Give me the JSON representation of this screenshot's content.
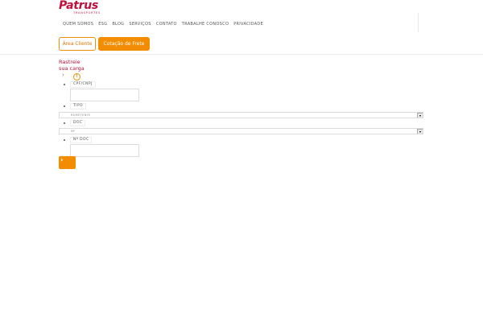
{
  "header": {
    "logo_text": "Patrus",
    "logo_subtext": "TRANSPORTES",
    "nav": [
      "QUEM SOMOS",
      "ESG",
      "BLOG",
      "SERVIÇOS",
      "CONTATO",
      "TRABALHE CONOSCO",
      "PRIVACIDADE"
    ],
    "area_cliente_label": "Área Cliente",
    "cotacao_label": "Cotação de Frete"
  },
  "tracking": {
    "title": "Rastreie sua carga",
    "chevron": "›",
    "info_icon": "!",
    "fields": {
      "cpf_label": "CPF/CNPJ",
      "cpf_value": "",
      "tipo_label": "TIPO",
      "tipo_selected": "REMETENTE",
      "doc_label": "DOC",
      "doc_selected": "NF",
      "ndoc_label": "Nº DOC",
      "ndoc_value": ""
    },
    "submit_glyph": "›"
  },
  "icons": {
    "chevron": "chevron-right-icon",
    "info": "info-icon",
    "submit": "chevron-right-icon"
  },
  "colors": {
    "brand": "#c0103c",
    "accent": "#f28c00"
  }
}
